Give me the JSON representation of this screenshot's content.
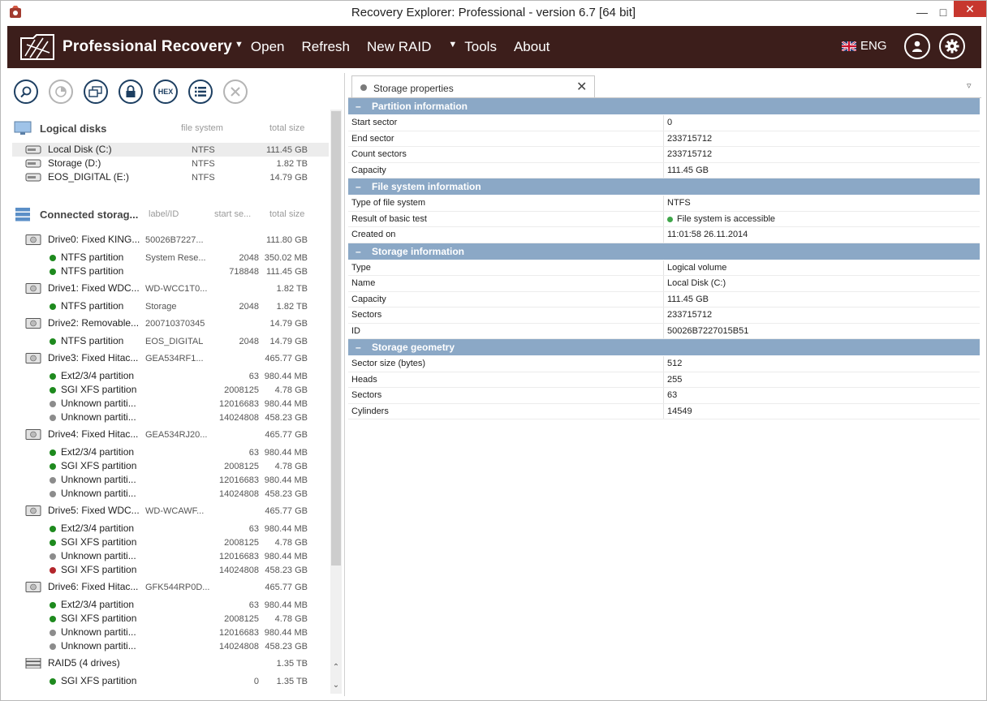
{
  "window": {
    "title": "Recovery Explorer: Professional - version 6.7 [64 bit]"
  },
  "menubar": {
    "brand": "Professional Recovery",
    "items": [
      {
        "label": "Open",
        "caret": true
      },
      {
        "label": "Refresh",
        "caret": false
      },
      {
        "label": "New RAID",
        "caret": false
      },
      {
        "label": "Tools",
        "caret": true
      },
      {
        "label": "About",
        "caret": false
      }
    ],
    "language": "ENG"
  },
  "toolbar": {
    "buttons": [
      "search-icon",
      "scan-icon",
      "image-icon",
      "lock-icon",
      "HEX",
      "list-icon",
      "close-icon"
    ],
    "hex_label": "HEX"
  },
  "logical_disks": {
    "title": "Logical disks",
    "col_fs": "file system",
    "col_size": "total size",
    "items": [
      {
        "name": "Local Disk (C:)",
        "fs": "NTFS",
        "size": "111.45 GB"
      },
      {
        "name": "Storage (D:)",
        "fs": "NTFS",
        "size": "1.82 TB"
      },
      {
        "name": "EOS_DIGITAL (E:)",
        "fs": "NTFS",
        "size": "14.79 GB"
      }
    ]
  },
  "connected": {
    "title": "Connected storag...",
    "col_label": "label/ID",
    "col_start": "start se...",
    "col_size": "total size",
    "rows": [
      {
        "type": "drive",
        "name": "Drive0: Fixed KING...",
        "label": "50026B7227...",
        "start": "",
        "size": "111.80 GB"
      },
      {
        "type": "part",
        "status": "green",
        "name": "NTFS partition",
        "label": "System Rese...",
        "start": "2048",
        "size": "350.02 MB"
      },
      {
        "type": "part",
        "status": "green",
        "name": "NTFS partition",
        "label": "",
        "start": "718848",
        "size": "111.45 GB"
      },
      {
        "type": "drive",
        "name": "Drive1: Fixed WDC...",
        "label": "WD-WCC1T0...",
        "start": "",
        "size": "1.82 TB"
      },
      {
        "type": "part",
        "status": "green",
        "name": "NTFS partition",
        "label": "Storage",
        "start": "2048",
        "size": "1.82 TB"
      },
      {
        "type": "drive",
        "name": "Drive2: Removable...",
        "label": "200710370345",
        "start": "",
        "size": "14.79 GB"
      },
      {
        "type": "part",
        "status": "green",
        "name": "NTFS partition",
        "label": "EOS_DIGITAL",
        "start": "2048",
        "size": "14.79 GB"
      },
      {
        "type": "drive",
        "name": "Drive3: Fixed Hitac...",
        "label": "GEA534RF1...",
        "start": "",
        "size": "465.77 GB"
      },
      {
        "type": "part",
        "status": "green",
        "name": "Ext2/3/4 partition",
        "label": "",
        "start": "63",
        "size": "980.44 MB"
      },
      {
        "type": "part",
        "status": "green",
        "name": "SGI XFS partition",
        "label": "",
        "start": "2008125",
        "size": "4.78 GB"
      },
      {
        "type": "part",
        "status": "gray",
        "name": "Unknown partiti...",
        "label": "",
        "start": "12016683",
        "size": "980.44 MB"
      },
      {
        "type": "part",
        "status": "gray",
        "name": "Unknown partiti...",
        "label": "",
        "start": "14024808",
        "size": "458.23 GB"
      },
      {
        "type": "drive",
        "name": "Drive4: Fixed Hitac...",
        "label": "GEA534RJ20...",
        "start": "",
        "size": "465.77 GB"
      },
      {
        "type": "part",
        "status": "green",
        "name": "Ext2/3/4 partition",
        "label": "",
        "start": "63",
        "size": "980.44 MB"
      },
      {
        "type": "part",
        "status": "green",
        "name": "SGI XFS partition",
        "label": "",
        "start": "2008125",
        "size": "4.78 GB"
      },
      {
        "type": "part",
        "status": "gray",
        "name": "Unknown partiti...",
        "label": "",
        "start": "12016683",
        "size": "980.44 MB"
      },
      {
        "type": "part",
        "status": "gray",
        "name": "Unknown partiti...",
        "label": "",
        "start": "14024808",
        "size": "458.23 GB"
      },
      {
        "type": "drive",
        "name": "Drive5: Fixed WDC...",
        "label": "WD-WCAWF...",
        "start": "",
        "size": "465.77 GB"
      },
      {
        "type": "part",
        "status": "green",
        "name": "Ext2/3/4 partition",
        "label": "",
        "start": "63",
        "size": "980.44 MB"
      },
      {
        "type": "part",
        "status": "green",
        "name": "SGI XFS partition",
        "label": "",
        "start": "2008125",
        "size": "4.78 GB"
      },
      {
        "type": "part",
        "status": "gray",
        "name": "Unknown partiti...",
        "label": "",
        "start": "12016683",
        "size": "980.44 MB"
      },
      {
        "type": "part",
        "status": "red",
        "name": "SGI XFS partition",
        "label": "",
        "start": "14024808",
        "size": "458.23 GB"
      },
      {
        "type": "drive",
        "name": "Drive6: Fixed Hitac...",
        "label": "GFK544RP0D...",
        "start": "",
        "size": "465.77 GB"
      },
      {
        "type": "part",
        "status": "green",
        "name": "Ext2/3/4 partition",
        "label": "",
        "start": "63",
        "size": "980.44 MB"
      },
      {
        "type": "part",
        "status": "green",
        "name": "SGI XFS partition",
        "label": "",
        "start": "2008125",
        "size": "4.78 GB"
      },
      {
        "type": "part",
        "status": "gray",
        "name": "Unknown partiti...",
        "label": "",
        "start": "12016683",
        "size": "980.44 MB"
      },
      {
        "type": "part",
        "status": "gray",
        "name": "Unknown partiti...",
        "label": "",
        "start": "14024808",
        "size": "458.23 GB"
      },
      {
        "type": "raid",
        "name": "RAID5 (4 drives)",
        "label": "",
        "start": "",
        "size": "1.35 TB"
      },
      {
        "type": "part",
        "status": "green",
        "name": "SGI XFS partition",
        "label": "",
        "start": "0",
        "size": "1.35 TB"
      }
    ]
  },
  "properties": {
    "tab_label": "Storage properties",
    "sections": [
      {
        "title": "Partition information",
        "rows": [
          {
            "k": "Start sector",
            "v": "0"
          },
          {
            "k": "End sector",
            "v": "233715712"
          },
          {
            "k": "Count sectors",
            "v": "233715712"
          },
          {
            "k": "Capacity",
            "v": "111.45 GB"
          }
        ]
      },
      {
        "title": "File system information",
        "rows": [
          {
            "k": "Type of file system",
            "v": "NTFS"
          },
          {
            "k": "Result of basic test",
            "v": "File system is accessible",
            "ok": true
          },
          {
            "k": "Created on",
            "v": "11:01:58 26.11.2014"
          }
        ]
      },
      {
        "title": "Storage information",
        "rows": [
          {
            "k": "Type",
            "v": "Logical volume"
          },
          {
            "k": "Name",
            "v": "Local Disk (C:)"
          },
          {
            "k": "Capacity",
            "v": "111.45 GB"
          },
          {
            "k": "Sectors",
            "v": "233715712"
          },
          {
            "k": "ID",
            "v": "50026B7227015B51"
          }
        ]
      },
      {
        "title": "Storage geometry",
        "rows": [
          {
            "k": "Sector size (bytes)",
            "v": "512"
          },
          {
            "k": "Heads",
            "v": "255"
          },
          {
            "k": "Sectors",
            "v": "63"
          },
          {
            "k": "Cylinders",
            "v": "14549"
          }
        ]
      }
    ]
  },
  "colors": {
    "menubar": "#3c1e1b",
    "section_header": "#8ba8c6",
    "ok": "#1e8a1e",
    "unknown": "#8c8c8c",
    "error": "#b3262c"
  }
}
